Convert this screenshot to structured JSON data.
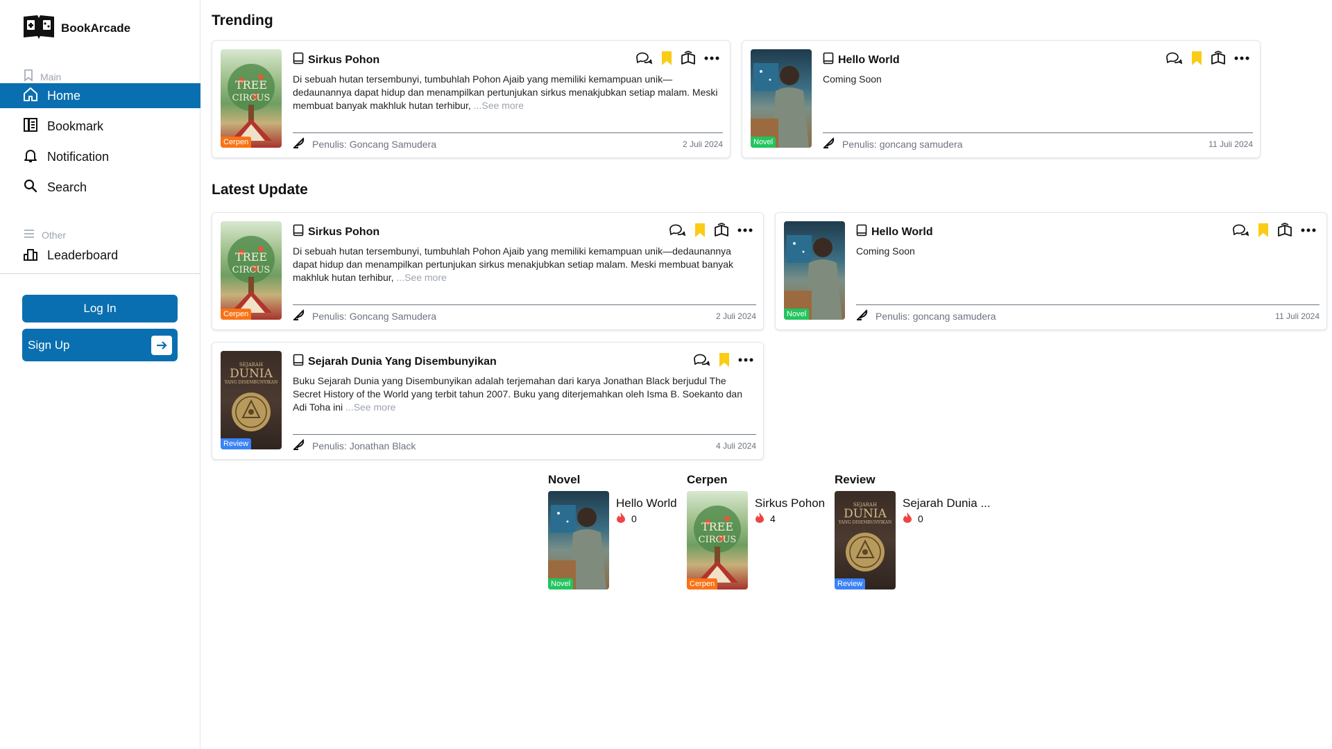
{
  "brand": {
    "name": "BookArcade"
  },
  "sidebar": {
    "main_label": "Main",
    "other_label": "Other",
    "items": [
      {
        "label": "Home"
      },
      {
        "label": "Bookmark"
      },
      {
        "label": "Notification"
      },
      {
        "label": "Search"
      }
    ],
    "other_items": [
      {
        "label": "Leaderboard"
      }
    ],
    "login_label": "Log In",
    "signup_label": "Sign Up"
  },
  "trending": {
    "heading": "Trending",
    "cards": [
      {
        "title": "Sirkus Pohon",
        "description": "Di sebuah hutan tersembunyi, tumbuhlah Pohon Ajaib yang memiliki kemampuan unik—dedaunannya dapat hidup dan menampilkan pertunjukan sirkus menakjubkan setiap malam. Meski membuat banyak makhluk hutan terhibur,",
        "see_more": "...See more",
        "author": "Penulis: Goncang Samudera",
        "date": "2 Juli 2024",
        "badge": "Cerpen"
      },
      {
        "title": "Hello World",
        "description": "Coming Soon",
        "author": "Penulis: goncang samudera",
        "date": "11 Juli 2024",
        "badge": "Novel"
      }
    ]
  },
  "latest": {
    "heading": "Latest Update",
    "cards": [
      {
        "title": "Sirkus Pohon",
        "description": "Di sebuah hutan tersembunyi, tumbuhlah Pohon Ajaib yang memiliki kemampuan unik—dedaunannya dapat hidup dan menampilkan pertunjukan sirkus menakjubkan setiap malam. Meski membuat banyak makhluk hutan terhibur,",
        "see_more": "...See more",
        "author": "Penulis: Goncang Samudera",
        "date": "2 Juli 2024",
        "badge": "Cerpen"
      },
      {
        "title": "Hello World",
        "description": "Coming Soon",
        "author": "Penulis: goncang samudera",
        "date": "11 Juli 2024",
        "badge": "Novel"
      },
      {
        "title": "Sejarah Dunia Yang Disembunyikan",
        "description": "Buku Sejarah Dunia yang Disembunyikan adalah terjemahan dari karya Jonathan Black berjudul The Secret History of the World yang terbit tahun 2007. Buku yang diterjemahkan oleh Isma B. Soekanto dan Adi Toha ini",
        "see_more": "...See more",
        "author": "Penulis: Jonathan Black",
        "date": "4 Juli 2024",
        "badge": "Review"
      }
    ]
  },
  "genres": [
    {
      "title": "Novel",
      "book": "Hello World",
      "count": "0",
      "badge": "Novel"
    },
    {
      "title": "Cerpen",
      "book": "Sirkus Pohon",
      "count": "4",
      "badge": "Cerpen"
    },
    {
      "title": "Review",
      "book": "Sejarah Dunia ...",
      "count": "0",
      "badge": "Review"
    }
  ],
  "covers": {
    "tree_line1": "TREE",
    "tree_line2": "CIRCUS",
    "dunia_top": "SEJARAH",
    "dunia_main": "DUNIA",
    "dunia_sub": "YANG DISEMBUNYIKAN"
  },
  "colors": {
    "accent": "#0a6fb0",
    "bookmark": "#facc15",
    "badge_cerpen": "#f97316",
    "badge_novel": "#22c55e",
    "badge_review": "#3b82f6",
    "flame": "#ef4444"
  }
}
